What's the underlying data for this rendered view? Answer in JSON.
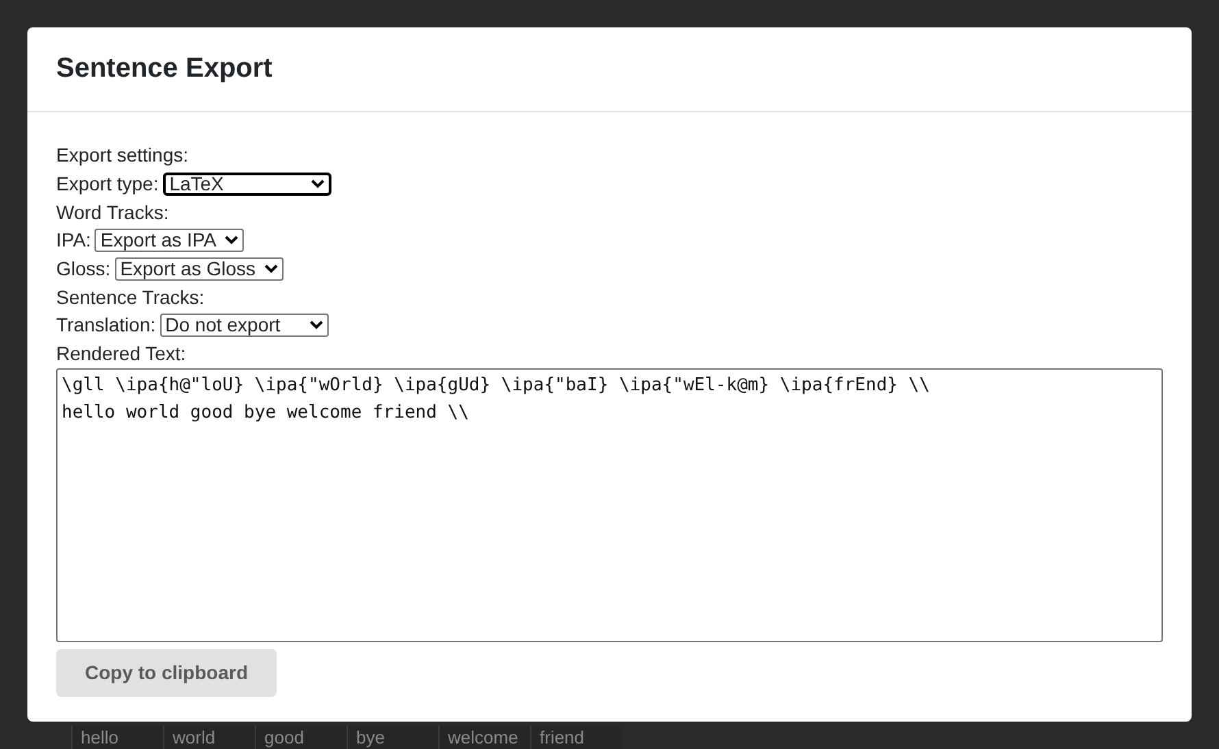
{
  "background": {
    "word_row": [
      "hello",
      "world",
      "good",
      "bye",
      "welcome",
      "friend"
    ]
  },
  "dialog": {
    "title": "Sentence Export",
    "section_label": "Export settings:",
    "fields": [
      {
        "kind": "select",
        "label": "Export type:",
        "value": "LaTeX",
        "focused": true
      },
      {
        "kind": "heading",
        "label": "Word Tracks:"
      },
      {
        "kind": "select",
        "label": "IPA:",
        "value": "Export as IPA",
        "focused": false
      },
      {
        "kind": "select",
        "label": "Gloss:",
        "value": "Export as Gloss",
        "focused": false
      },
      {
        "kind": "heading",
        "label": "Sentence Tracks:"
      },
      {
        "kind": "select",
        "label": "Translation:",
        "value": "Do not export",
        "focused": false
      }
    ],
    "rendered_label": "Rendered Text:",
    "rendered_text": "\\gll \\ipa{h@\"loU} \\ipa{\"wOrld} \\ipa{gUd} \\ipa{\"baI} \\ipa{\"wEl-k@m} \\ipa{frEnd} \\\\\nhello world good bye welcome friend \\\\",
    "button": "Copy to clipboard"
  }
}
